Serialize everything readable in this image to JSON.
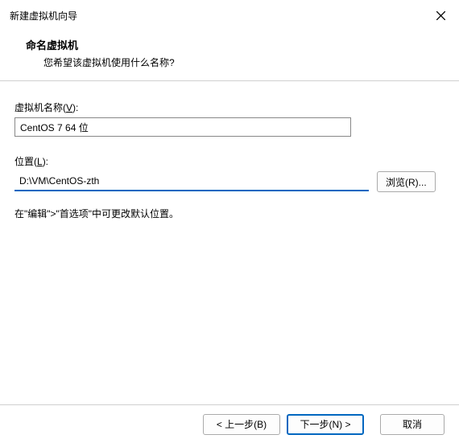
{
  "window": {
    "title": "新建虚拟机向导"
  },
  "header": {
    "heading": "命名虚拟机",
    "subheading": "您希望该虚拟机使用什么名称?"
  },
  "fields": {
    "name_label_prefix": "虚拟机名称(",
    "name_label_key": "V",
    "name_label_suffix": "):",
    "name_value": "CentOS 7 64 位",
    "location_label_prefix": "位置(",
    "location_label_key": "L",
    "location_label_suffix": "):",
    "location_value": "D:\\VM\\CentOS-zth",
    "browse_prefix": "浏览(",
    "browse_key": "R",
    "browse_suffix": ")..."
  },
  "hint": "在\"编辑\">\"首选项\"中可更改默认位置。",
  "footer": {
    "back_prefix": "< 上一步(",
    "back_key": "B",
    "back_suffix": ")",
    "next_prefix": "下一步(",
    "next_key": "N",
    "next_suffix": ") >",
    "cancel": "取消"
  }
}
